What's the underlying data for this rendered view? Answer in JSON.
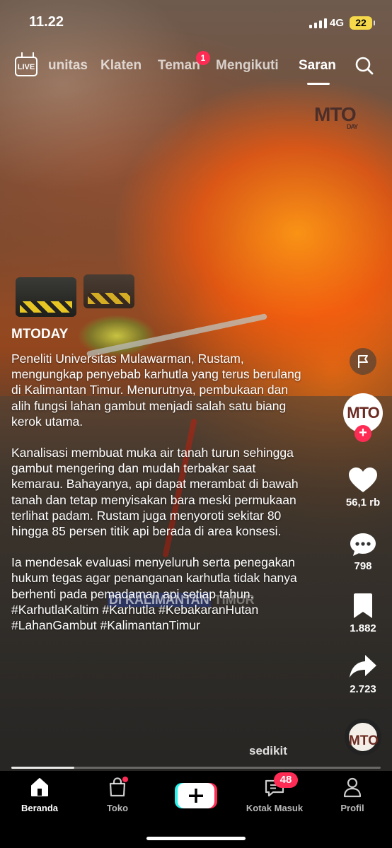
{
  "status_bar": {
    "time": "11.22",
    "network": "4G",
    "battery": "22"
  },
  "top_nav": {
    "live_label": "LIVE",
    "tabs": [
      {
        "label": "unitas"
      },
      {
        "label": "Klaten"
      },
      {
        "label": "Teman",
        "badge": "1"
      },
      {
        "label": "Mengikuti"
      },
      {
        "label": "Saran",
        "active": true
      }
    ]
  },
  "video": {
    "watermark": "MTO",
    "watermark_sub": "DAY",
    "caption_overlay_highlight": "DI KALIMANTAN",
    "caption_overlay_rest": " TIMUR"
  },
  "post": {
    "author": "MTODAY",
    "paragraphs": [
      "Peneliti Universitas Mulawarman, Rustam, mengungkap penyebab karhutla yang terus berulang di Kalimantan Timur. Menurutnya, pembukaan dan alih fungsi lahan gambut menjadi salah satu biang kerok utama.",
      "Kanalisasi membuat muka air tanah turun sehingga gambut mengering dan mudah terbakar saat kemarau. Bahayanya, api dapat merambat di bawah tanah dan tetap menyisakan bara meski permukaan terlihat padam. Rustam juga menyoroti sekitar 80 hingga 85 persen titik api berada di area konsesi.",
      "Ia mendesak evaluasi menyeluruh serta penegakan hukum tegas agar penanganan karhutla tidak hanya berhenti pada pemadaman api setiap tahun."
    ],
    "hashtags": "#KarhutlaKaltim #Karhutla #KebakaranHutan #LahanGambut #KalimantanTimur",
    "less_label": "sedikit",
    "progress": 0.17
  },
  "rail": {
    "avatar_text": "MTO",
    "likes": "56,1 rb",
    "comments": "798",
    "saves": "1.882",
    "shares": "2.723"
  },
  "bottom_nav": {
    "items": [
      {
        "label": "Beranda",
        "active": true
      },
      {
        "label": "Toko"
      },
      {
        "label": "Kotak Masuk",
        "badge": "48"
      },
      {
        "label": "Profil"
      }
    ]
  },
  "colors": {
    "accent": "#fe2c55",
    "cyan": "#25f4ee",
    "battery": "#f5d94a"
  }
}
